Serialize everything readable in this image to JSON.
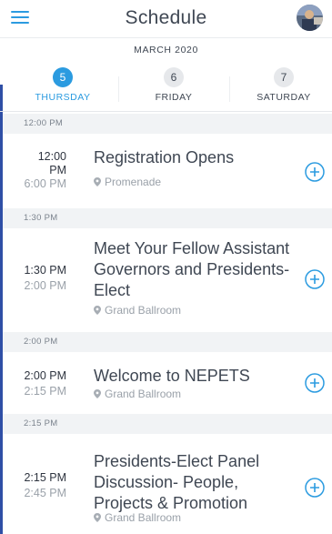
{
  "header": {
    "title": "Schedule",
    "menu_icon": "hamburger-menu-icon",
    "avatar_icon": "user-avatar"
  },
  "month": "MARCH 2020",
  "days": [
    {
      "num": "5",
      "name": "THURSDAY",
      "active": true
    },
    {
      "num": "6",
      "name": "FRIDAY",
      "active": false
    },
    {
      "num": "7",
      "name": "SATURDAY",
      "active": false
    }
  ],
  "slots": [
    {
      "header": "12:00 PM"
    },
    {
      "header": "1:30 PM"
    },
    {
      "header": "2:00 PM"
    },
    {
      "header": "2:15 PM"
    }
  ],
  "sessions": [
    {
      "start": "12:00 PM",
      "end": "6:00 PM",
      "title": "Registration Opens",
      "location": "Promenade"
    },
    {
      "start": "1:30 PM",
      "end": "2:00 PM",
      "title": "Meet Your Fellow Assistant Governors  and Presidents-Elect",
      "location": "Grand Ballroom"
    },
    {
      "start": "2:00 PM",
      "end": "2:15 PM",
      "title": "Welcome to NEPETS",
      "location": "Grand Ballroom"
    },
    {
      "start": "2:15 PM",
      "end": "2:45 PM",
      "title": "Presidents-Elect Panel Discussion- People, Projects & Promotion",
      "location": "Grand Ballroom"
    }
  ],
  "colors": {
    "accent": "#2b9be0",
    "left_rule": "#2f4fa6",
    "slot_bg": "#f1f3f5"
  }
}
